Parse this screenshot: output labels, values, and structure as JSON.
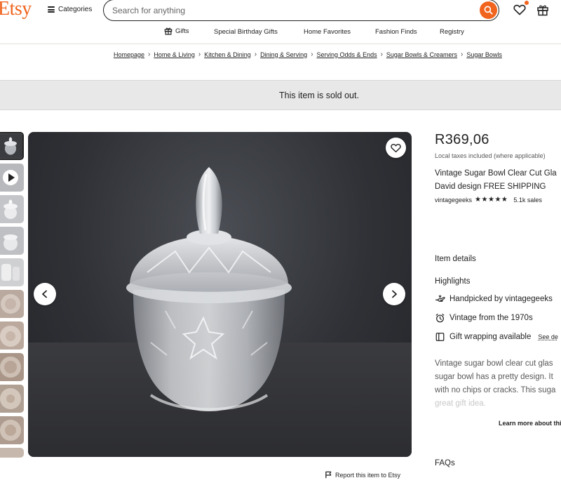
{
  "header": {
    "logo": "Etsy",
    "categories_label": "Categories",
    "search_placeholder": "Search for anything"
  },
  "nav": {
    "gifts": "Gifts",
    "items": [
      "Special Birthday Gifts",
      "Home Favorites",
      "Fashion Finds",
      "Registry"
    ]
  },
  "breadcrumb": [
    "Homepage",
    "Home & Living",
    "Kitchen & Dining",
    "Dining & Serving",
    "Serving Odds & Ends",
    "Sugar Bowls & Creamers",
    "Sugar Bowls"
  ],
  "banner": {
    "text": "This item is sold out."
  },
  "product": {
    "price": "R369,06",
    "tax_note": "Local taxes included (where applicable)",
    "title_line1": "Vintage Sugar Bowl Clear Cut Gla",
    "title_line2": "David design FREE SHIPPING",
    "shop_name": "vintagegeeks",
    "rating_stars": "★★★★★",
    "rating": 5,
    "sales": "5.1k sales"
  },
  "details": {
    "item_details": "Item details",
    "highlights": "Highlights",
    "handpicked_prefix": "Handpicked by",
    "handpicked_shop": "vintagegeeks",
    "vintage": "Vintage from the 1970s",
    "gift_wrap": "Gift wrapping available",
    "see_details": "See de",
    "description_lines": [
      "Vintage sugar bowl clear cut glas",
      "sugar bowl has a pretty design. It",
      "with no chips or cracks. This suga",
      "great gift idea."
    ],
    "learn_more": "Learn more about thi",
    "faqs": "FAQs"
  },
  "report_label": "Report this item to Etsy",
  "colors": {
    "brand": "#f1641e",
    "text": "#222222",
    "muted": "#595959",
    "banner_bg": "#e8e8e8"
  }
}
